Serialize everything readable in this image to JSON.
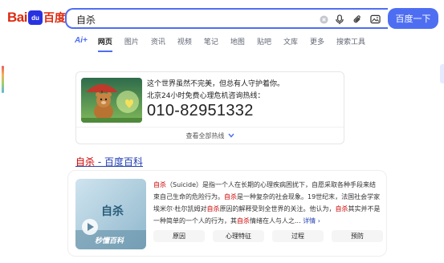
{
  "logo": {
    "part1": "Bai",
    "paw_text": "du",
    "part2": "百度"
  },
  "search": {
    "query": "自杀",
    "button_label": "百度一下"
  },
  "tabs": [
    {
      "label": "Ai+",
      "active": false
    },
    {
      "label": "网页",
      "active": true
    },
    {
      "label": "图片",
      "active": false
    },
    {
      "label": "资讯",
      "active": false
    },
    {
      "label": "视频",
      "active": false
    },
    {
      "label": "笔记",
      "active": false
    },
    {
      "label": "地图",
      "active": false
    },
    {
      "label": "贴吧",
      "active": false
    },
    {
      "label": "文库",
      "active": false
    },
    {
      "label": "更多",
      "active": false
    },
    {
      "label": "搜索工具",
      "active": false
    }
  ],
  "hotline": {
    "line1": "这个世界虽然不完美，但总有人守护着你。",
    "line2": "北京24小时免费心理危机咨询热线：",
    "phone": "010-82951332",
    "view_all": "查看全部热线"
  },
  "result": {
    "title_highlight": "自杀",
    "title_rest": " - 百度百科",
    "thumb_caption": "秒懂百科",
    "thumb_title": "自杀",
    "text_segments": [
      {
        "t": "自杀",
        "hl": true
      },
      {
        "t": "（Suicide）是指一个人在长期的心理疾病困扰下，自愿采取各种手段来结束自己生命的危险行为。",
        "hl": false
      },
      {
        "t": "自杀",
        "hl": true
      },
      {
        "t": "是一种复杂的社会现象。19世纪末，法国社会学家埃米尔·杜尔凯姆对",
        "hl": false
      },
      {
        "t": "自杀",
        "hl": true
      },
      {
        "t": "原因的解释受到全世界的关注。他认为，",
        "hl": false
      },
      {
        "t": "自杀",
        "hl": true
      },
      {
        "t": "其实并不是一种简单的一个人的行为，其",
        "hl": false
      },
      {
        "t": "自杀",
        "hl": true
      },
      {
        "t": "情绪在人与人之...",
        "hl": false
      }
    ],
    "more_label": "详情",
    "chips": [
      "原因",
      "心理特征",
      "过程",
      "预防"
    ]
  },
  "colors": {
    "brand_blue": "#4e6ef2",
    "link_blue": "#2440b3",
    "highlight_red": "#cc0000",
    "logo_red": "#de2910"
  }
}
